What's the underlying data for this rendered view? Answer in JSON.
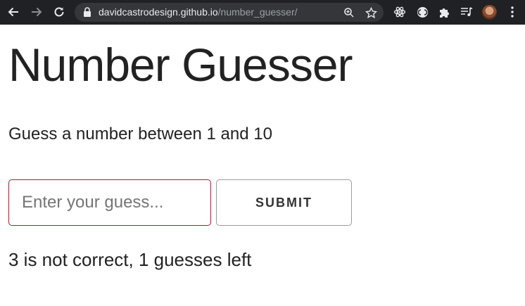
{
  "browser": {
    "url_host": "davidcastrodesign.github.io",
    "url_path": "/number_guesser/",
    "icons": [
      "back-icon",
      "forward-icon",
      "reload-icon",
      "lock-icon",
      "zoom-icon",
      "bookmark-star-icon",
      "react-devtools-icon",
      "extension-icon",
      "extensions-puzzle-icon",
      "media-queue-icon",
      "profile-avatar",
      "menu-dots-icon"
    ]
  },
  "page": {
    "title": "Number Guesser",
    "instructions": "Guess a number between 1 and 10",
    "input_placeholder": "Enter your guess...",
    "input_value": "",
    "submit_label": "SUBMIT",
    "feedback": "3 is not correct, 1 guesses left"
  },
  "colors": {
    "toolbar_bg": "#202124",
    "input_border": "#cc0a33",
    "text": "#222222"
  }
}
